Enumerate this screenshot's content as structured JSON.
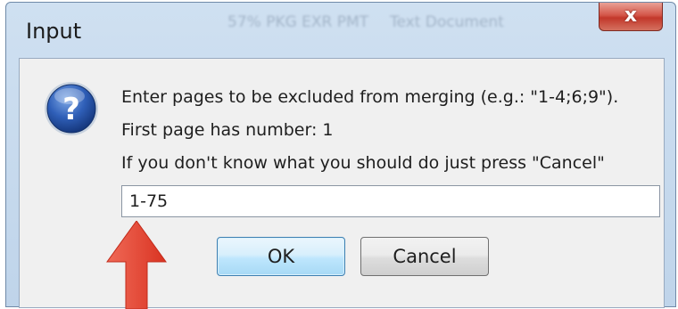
{
  "window": {
    "title": "Input",
    "background_title_fragments": [
      "57% PKG EXR PMT",
      "Text Document"
    ],
    "close_label": "x"
  },
  "message": {
    "line1": "Enter pages to be excluded from merging (e.g.: \"1-4;6;9\").",
    "line2": "First page has number: 1",
    "line3": "If you don't know what you should do just press \"Cancel\""
  },
  "input": {
    "value": "1-75"
  },
  "buttons": {
    "ok_label": "OK",
    "cancel_label": "Cancel"
  },
  "icons": {
    "question": "question-icon",
    "annotation_arrow": "red-arrow-annotation"
  },
  "colors": {
    "arrow": "#e8402e",
    "ok_border": "#3c7fb1",
    "close_button": "#c8463a"
  }
}
